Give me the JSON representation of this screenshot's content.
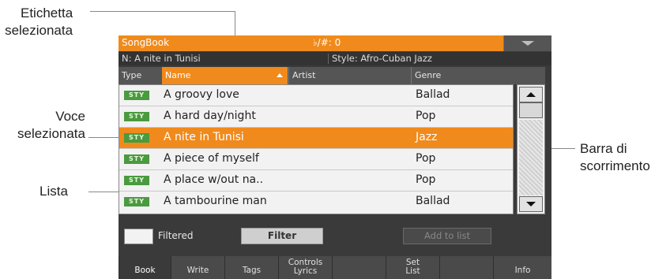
{
  "annotations": {
    "selected_label": [
      "Etichetta",
      "selezionata"
    ],
    "selected_item": [
      "Voce",
      "selezionata"
    ],
    "list": "Lista",
    "scrollbar": [
      "Barra di",
      "scorrimento"
    ]
  },
  "topbar": {
    "title": "SongBook",
    "key": "♭/#: 0"
  },
  "info": {
    "name": "N: A nite in Tunisi",
    "style": "Style: Afro-Cuban Jazz"
  },
  "columns": {
    "type": "Type",
    "name": "Name",
    "artist": "Artist",
    "genre": "Genre"
  },
  "rows": [
    {
      "type": "STY",
      "name": "A groovy love",
      "genre": "Ballad",
      "selected": false
    },
    {
      "type": "STY",
      "name": "A hard day/night",
      "genre": "Pop",
      "selected": false
    },
    {
      "type": "STY",
      "name": "A nite in Tunisi",
      "genre": "Jazz",
      "selected": true
    },
    {
      "type": "STY",
      "name": "A piece of myself",
      "genre": "Pop",
      "selected": false
    },
    {
      "type": "STY",
      "name": "A place w/out na..",
      "genre": "Pop",
      "selected": false
    },
    {
      "type": "STY",
      "name": "A tambourine man",
      "genre": "Ballad",
      "selected": false
    }
  ],
  "controls": {
    "filtered_label": "Filtered",
    "filter_button": "Filter",
    "add_button": "Add to list"
  },
  "tabs": [
    {
      "label": [
        "Book"
      ],
      "active": true
    },
    {
      "label": [
        "Write"
      ],
      "active": false
    },
    {
      "label": [
        "Tags"
      ],
      "active": false
    },
    {
      "label": [
        "Controls",
        "Lyrics"
      ],
      "active": false
    },
    {
      "label": [
        ""
      ],
      "active": false
    },
    {
      "label": [
        "Set",
        "List"
      ],
      "active": false
    },
    {
      "label": [
        ""
      ],
      "active": false
    },
    {
      "label": [
        "Info"
      ],
      "active": false
    }
  ],
  "colors": {
    "accent": "#f08a1c",
    "badge": "#4a9a3f",
    "screen_bg": "#3a3a3a",
    "list_bg": "#f2f2f2"
  }
}
